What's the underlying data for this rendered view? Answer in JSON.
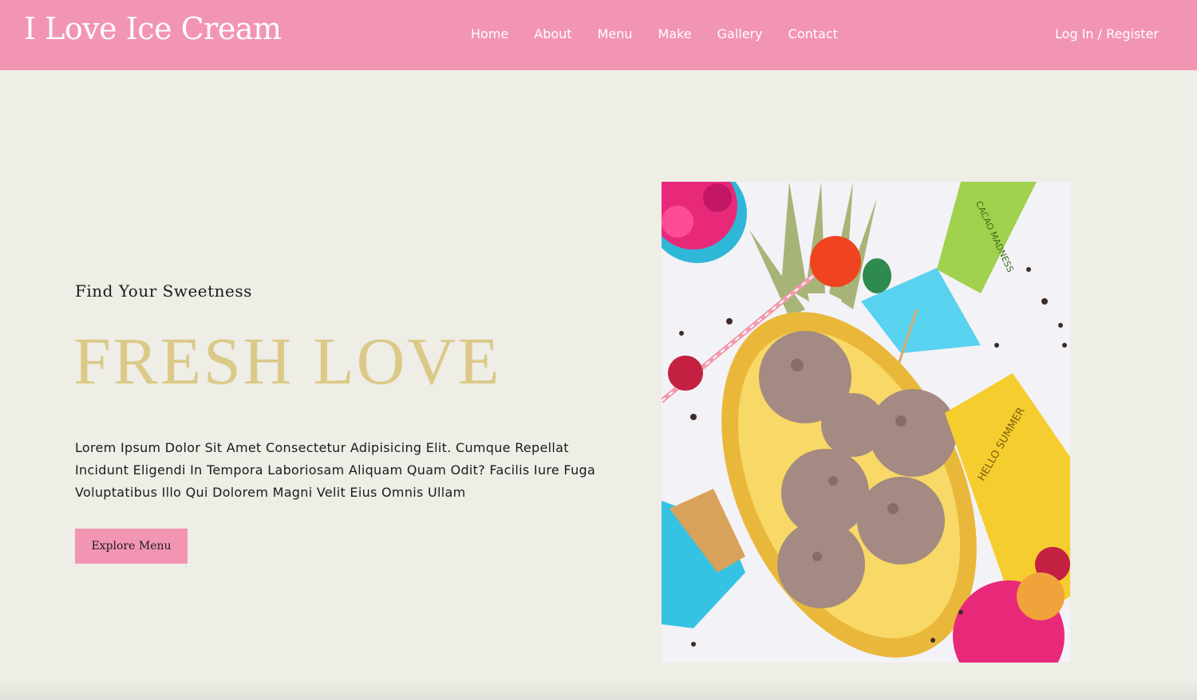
{
  "header": {
    "logo": "I Love Ice Cream",
    "nav": [
      {
        "label": "Home"
      },
      {
        "label": "About"
      },
      {
        "label": "Menu"
      },
      {
        "label": "Make"
      },
      {
        "label": "Gallery"
      },
      {
        "label": "Contact"
      }
    ],
    "login": "Log In / Register"
  },
  "hero": {
    "subtitle": "Find Your Sweetness",
    "title": "FRESH LOVE",
    "text": "Lorem Ipsum Dolor Sit Amet Consectetur Adipisicing Elit. Cumque Repellat Incidunt Eligendi In Tempora Laboriosam Aliquam Quam Odit? Facilis Iure Fuga Voluptatibus Illo Qui Dolorem Magni Velit Eius Omnis Ullam",
    "button": "Explore Menu",
    "image": {
      "cup_top_text": "CACAO MADNESS",
      "cup_bottom_text": "HELLO SUMMER"
    }
  },
  "colors": {
    "brand_pink": "#f295b3",
    "gold_title": "#dbc987",
    "background": "#eeede6"
  }
}
